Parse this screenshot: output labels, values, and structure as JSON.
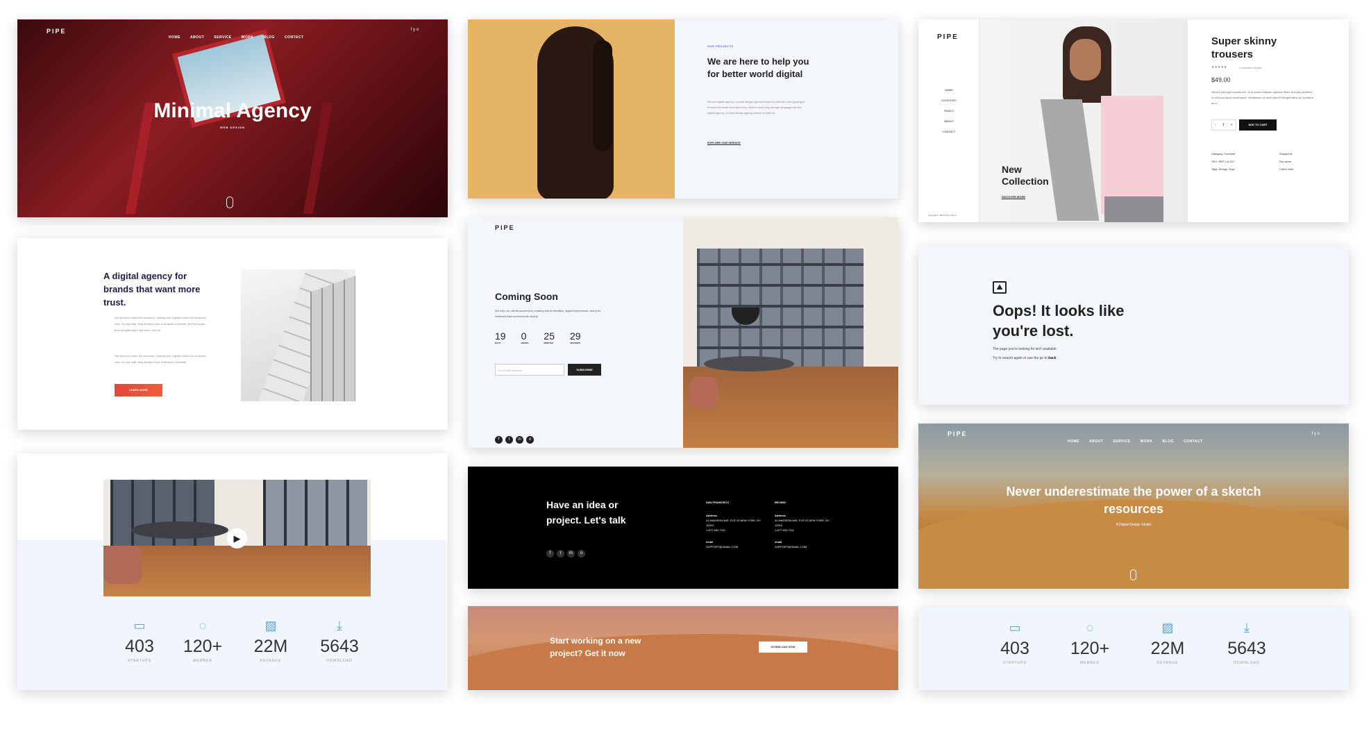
{
  "c1": {
    "logo": "PIPE",
    "nav": [
      "HOME",
      "ABOUT",
      "SERVICE",
      "WORK",
      "BLOG",
      "CONTACT"
    ],
    "social": "f  y  o",
    "title": "Minimal Agency",
    "subtitle": "WEB DESIGN"
  },
  "c2": {
    "label": "OUR PROJECTS",
    "heading": "We are here to help you for better world digital",
    "body": "We are digital agency, a small design agency based in paris as i was groping to remove the chain from about my victim's neck only through language.We are digital agency, a small design agency based in paris as.",
    "link": "EXPLORE OUR SERVICE"
  },
  "c3": {
    "logo": "PIPE",
    "menu": [
      "HOME",
      "CATEGORY",
      "PAGES",
      "ABOUT",
      "CONTACT"
    ],
    "copyright": "Copyright © 2019 Pipe Theme",
    "collection": "New Collection",
    "discover": "DISCOVER MORE",
    "product": "Super skinny trousers",
    "stars": "★★★★★",
    "review": "1 customer review",
    "price": "$49.00",
    "desc": "ultrices just eget sodales est. Duis ipsum Aliquam egestas libero at turpis pharetra, in vehicula lacus scelerisque. Vestibulum sit amet laoreet feugiat tellus at, hendrerit arcu.",
    "qty_minus": "-",
    "qty": "1",
    "qty_plus": "+",
    "add_to_cart": "ADD TO CART",
    "meta_left": [
      "Category: Furniture",
      "SKU: REF. LA-107",
      "Tags: Design, Toys"
    ],
    "meta_right": [
      "Straight fit",
      "Dry clean",
      "Cotton shirt"
    ]
  },
  "c4": {
    "heading": "A digital agency for brands that want more trust.",
    "p1": "We stood on board the schooner. Hosting sail. it glided down the Acushnet river. On one side, New Bedford rose in terraces of streets, their ice-cover trees all glittering in the clear, cold air.",
    "p2": "We stood on board the schooner. Hosting sail. it glided down the Acushnet river. On one side, New Bedford rose in terraces of streets.",
    "button": "LEARN MORE"
  },
  "c5": {
    "logo": "PIPE",
    "title": "Coming Soon",
    "body": "We help our clients succeed by creating brand identities, digital experiences, and print materials that communicate clearly.",
    "counts": [
      {
        "n": "19",
        "l": "DAYS"
      },
      {
        "n": "0",
        "l": "HOURS"
      },
      {
        "n": "25",
        "l": "MINUTES"
      },
      {
        "n": "29",
        "l": "SECONDS"
      }
    ],
    "email_placeholder": "Your Email Address",
    "subscribe": "SUBSCRIBE",
    "social": [
      "f",
      "t",
      "in",
      "o"
    ]
  },
  "c6": {
    "heading": "Oops! It looks like you're lost.",
    "line1": "The page you're looking for isn't available",
    "line2_prefix": "Try to search again or use the go to",
    "line2_link": "back"
  },
  "stats": [
    {
      "n": "403",
      "l": "STARTUPS"
    },
    {
      "n": "120+",
      "l": "MEMBER"
    },
    {
      "n": "22M",
      "l": "REVENUE"
    },
    {
      "n": "5643",
      "l": "DOWNLOAD"
    }
  ],
  "c8": {
    "heading": "Have an idea or project. Let's talk",
    "social": [
      "f",
      "t",
      "in",
      "o"
    ],
    "cols": [
      {
        "city": "SAN FRANCISCO",
        "addr_label": "Address",
        "addr": "41 MADISON AVE, FLR 22 NEW YORK, NY 10010",
        "phone": "1-877-932-7111",
        "email_label": "email",
        "email": "SUPPORT@GMAIL.COM"
      },
      {
        "city": "BEIJING",
        "addr_label": "Address",
        "addr": "41 MADISON AVE, FLR 22 NEW YORK, NY 10010",
        "phone": "1-877-932-7111",
        "email_label": "email",
        "email": "SUPPORT@GMAIL.COM"
      }
    ]
  },
  "c9": {
    "logo": "PIPE",
    "nav": [
      "HOME",
      "ABOUT",
      "SERVICE",
      "WORK",
      "BLOG",
      "CONTACT"
    ],
    "social": "f  y  o",
    "title": "Never underestimate the power of a sketch resources",
    "subtitle": "A Digital Design Studio"
  },
  "c10": {
    "heading": "Start working on a new project? Get it now",
    "button": "DOWNLOAD NOW"
  }
}
